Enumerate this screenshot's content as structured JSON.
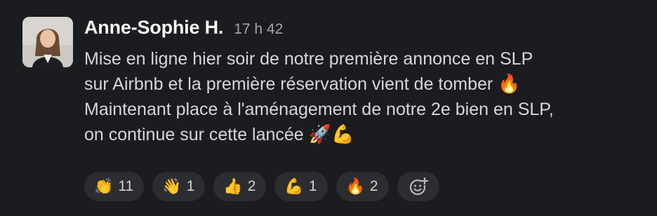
{
  "message": {
    "author": "Anne-Sophie H.",
    "timestamp": "17 h 42",
    "lines": [
      "Mise en ligne hier soir de notre première annonce en SLP",
      "sur Airbnb et la première réservation vient de tomber",
      "Maintenant place à l'aménagement de notre 2e bien en SLP,",
      "on continue sur cette lancée"
    ],
    "emoji_fire": "🔥",
    "emoji_rocket": "🚀",
    "emoji_muscle": "💪"
  },
  "reactions": [
    {
      "icon": "clapping-hands-icon",
      "emoji": "👏",
      "count": "11"
    },
    {
      "icon": "waving-hand-icon",
      "emoji": "👋",
      "count": "1"
    },
    {
      "icon": "thumbs-up-icon",
      "emoji": "👍",
      "count": "2"
    },
    {
      "icon": "flexed-biceps-icon",
      "emoji": "💪",
      "count": "1"
    },
    {
      "icon": "fire-icon",
      "emoji": "🔥",
      "count": "2"
    }
  ],
  "add_reaction_icon": "add-emoji-icon",
  "colors": {
    "background": "#1b1c1f",
    "pill": "#2c2d31",
    "author": "#f8f8f8",
    "timestamp": "#a5a6a8"
  }
}
